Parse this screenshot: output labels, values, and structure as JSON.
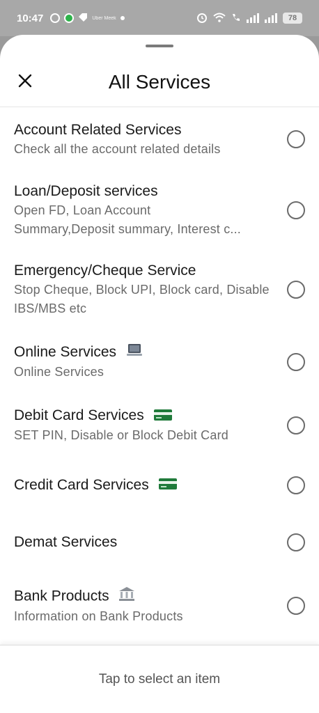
{
  "status_bar": {
    "time": "10:47",
    "ticker": "Uber Meek",
    "battery": "78"
  },
  "header": {
    "title": "All Services",
    "close_icon": "close-icon"
  },
  "items": [
    {
      "title": "Account Related Services",
      "subtitle": "Check all the account related details",
      "selected": false
    },
    {
      "title": "Loan/Deposit services",
      "subtitle": "Open FD, Loan Account Summary,Deposit summary, Interest c...",
      "selected": false
    },
    {
      "title": "Emergency/Cheque Service",
      "subtitle": "Stop Cheque, Block UPI, Block card, Disable IBS/MBS etc",
      "selected": false
    },
    {
      "title": "Online Services",
      "subtitle": "Online Services",
      "icon": "laptop-icon",
      "selected": false
    },
    {
      "title": "Debit Card Services",
      "subtitle": "SET PIN, Disable or Block Debit Card",
      "icon": "card-icon",
      "selected": false
    },
    {
      "title": "Credit Card Services",
      "subtitle": "",
      "icon": "card-icon",
      "selected": false
    },
    {
      "title": "Demat Services",
      "subtitle": "",
      "selected": false
    },
    {
      "title": "Bank Products",
      "subtitle": "Information on Bank Products",
      "icon": "bank-icon",
      "selected": false
    }
  ],
  "footer": {
    "hint": "Tap to select an item"
  },
  "colors": {
    "radio_border": "#6b6b6b",
    "card_green": "#1f7a3a"
  }
}
